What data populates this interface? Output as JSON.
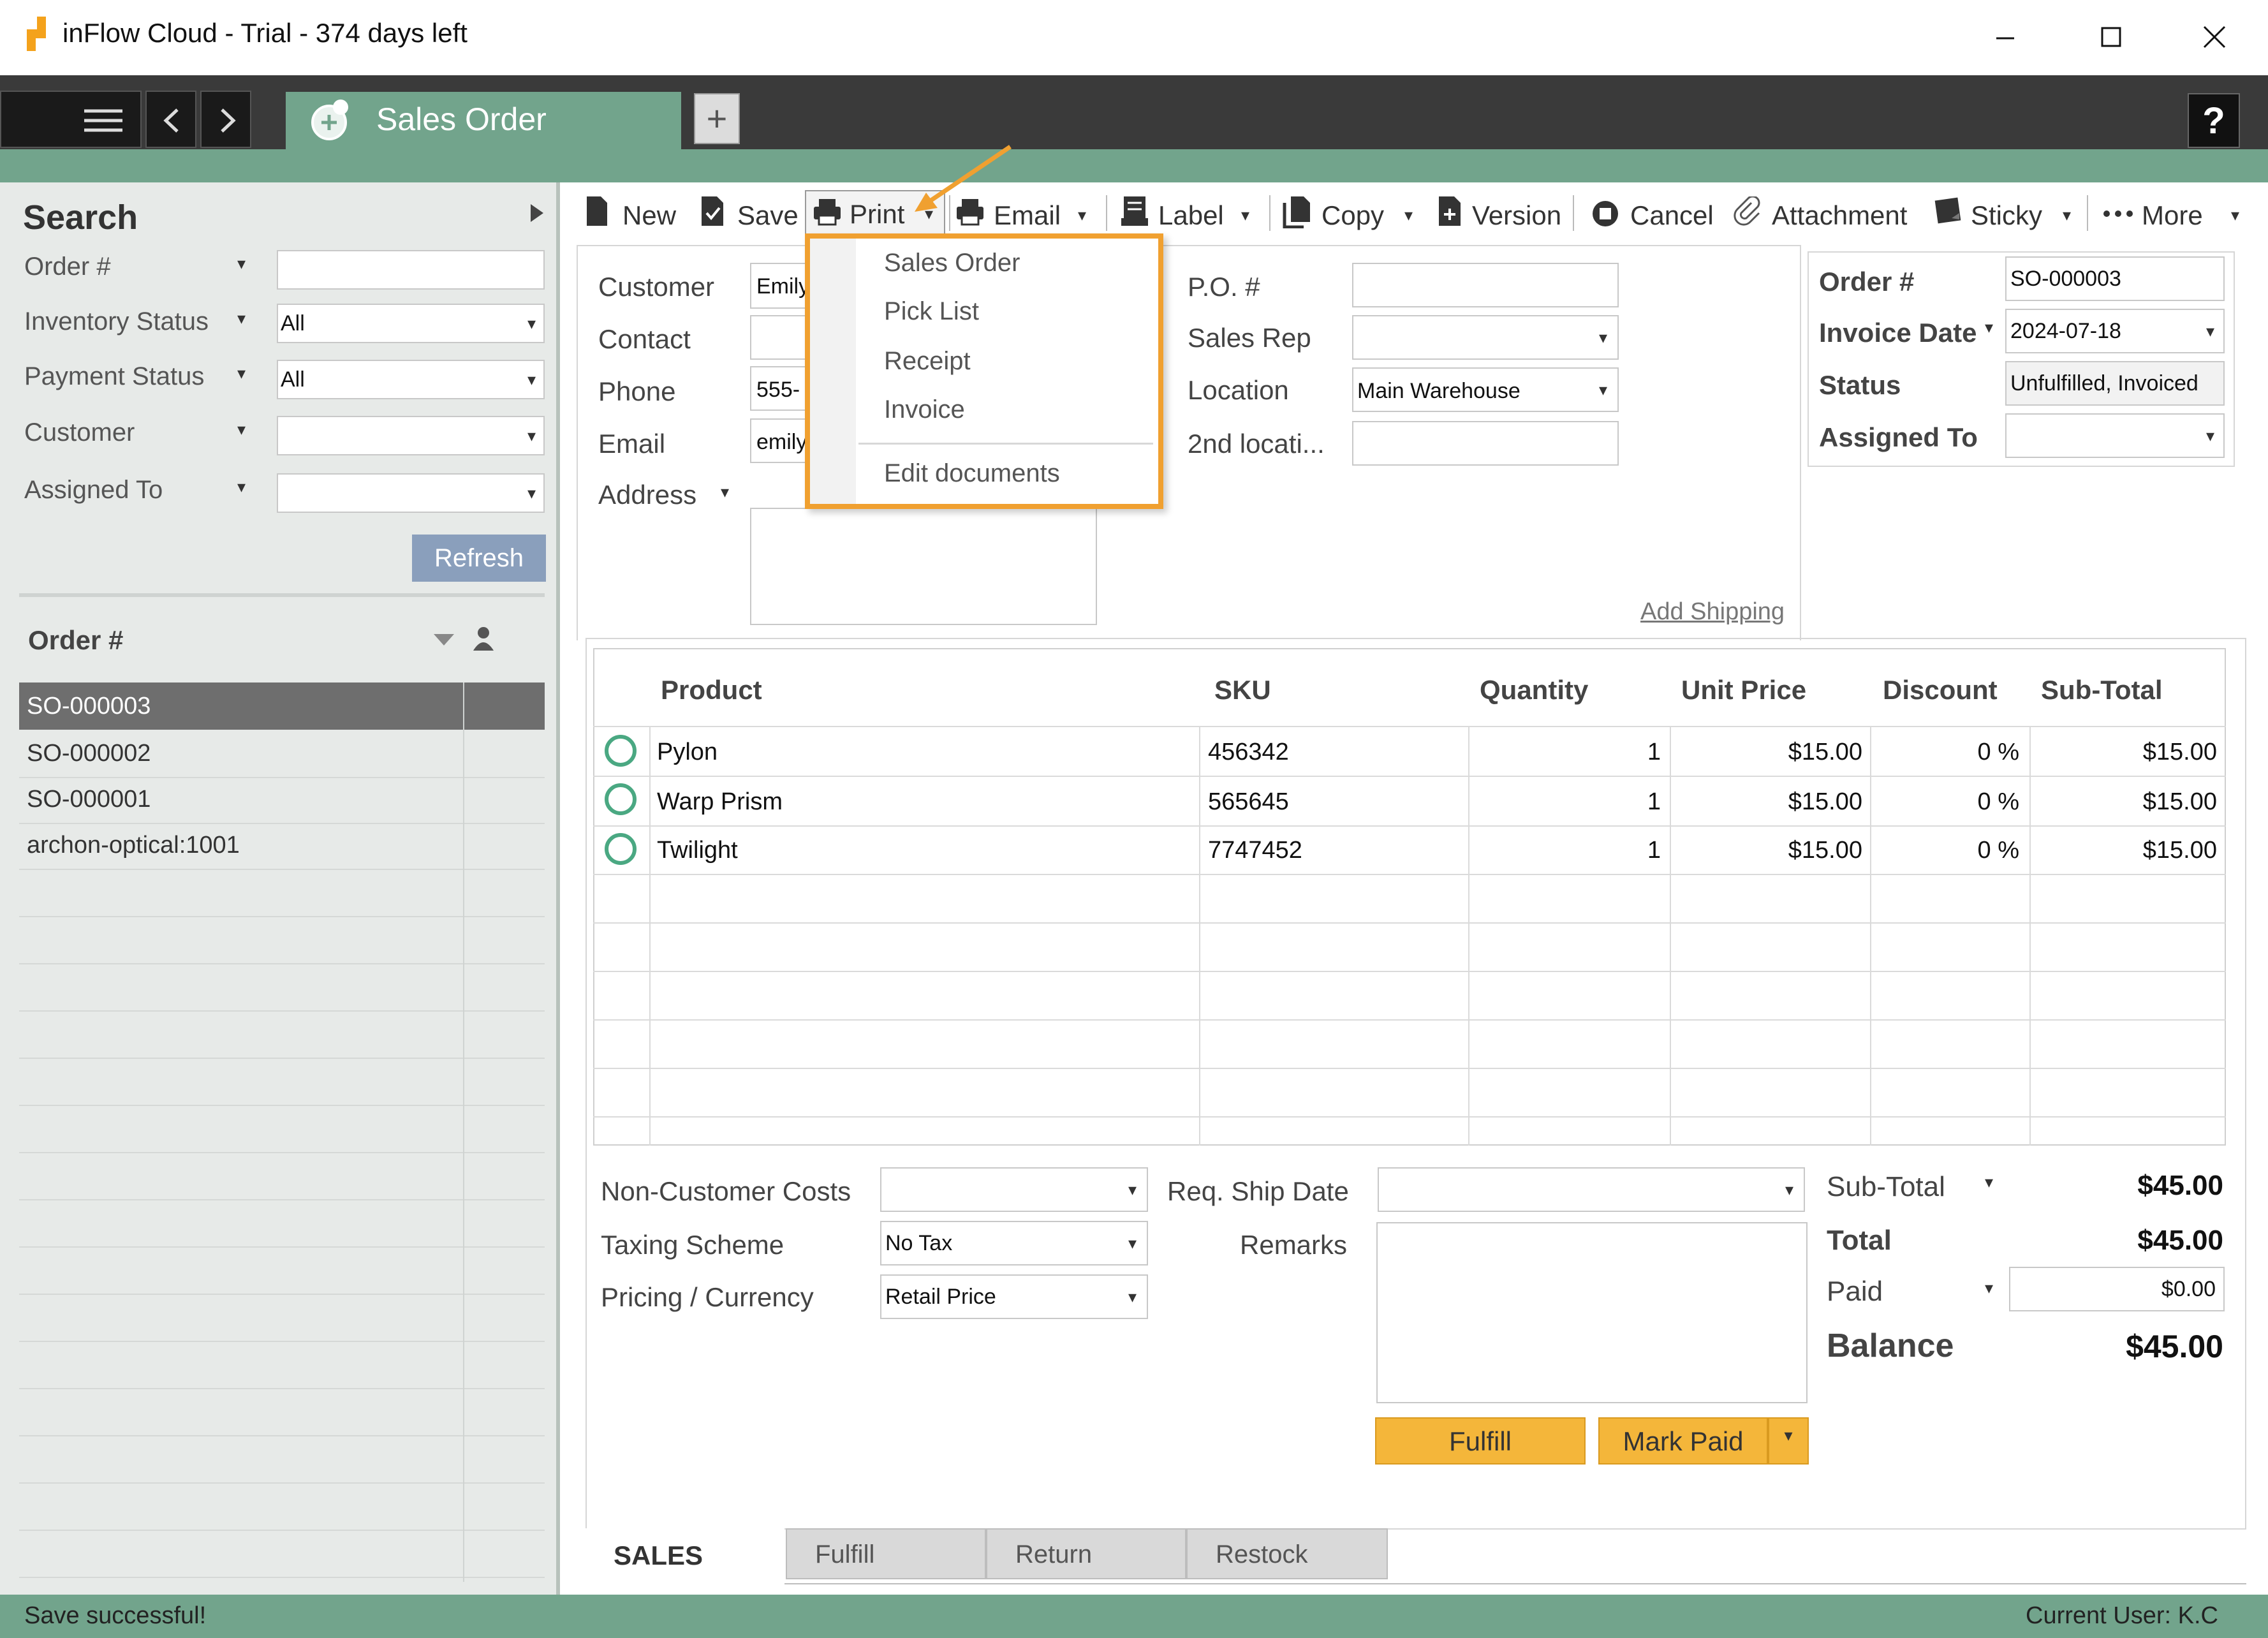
{
  "app": {
    "title": "inFlow Cloud - Trial - 374 days left"
  },
  "tabs": {
    "active_label": "Sales Order",
    "new_tab": "+",
    "help": "?"
  },
  "search": {
    "title": "Search",
    "fields": [
      {
        "label": "Order #",
        "value": ""
      },
      {
        "label": "Inventory Status",
        "value": "All"
      },
      {
        "label": "Payment Status",
        "value": "All"
      },
      {
        "label": "Customer",
        "value": ""
      },
      {
        "label": "Assigned To",
        "value": ""
      }
    ],
    "refresh_label": "Refresh",
    "list_header": "Order #",
    "orders": [
      "SO-000003",
      "SO-000002",
      "SO-000001",
      "archon-optical:1001"
    ],
    "selected_index": 0
  },
  "toolbar": {
    "new": "New",
    "save": "Save",
    "print": "Print",
    "email": "Email",
    "label": "Label",
    "copy": "Copy",
    "version": "Version",
    "cancel": "Cancel",
    "attachment": "Attachment",
    "sticky": "Sticky",
    "more": "More"
  },
  "print_menu": {
    "items": [
      "Sales Order",
      "Pick List",
      "Receipt",
      "Invoice"
    ],
    "edit_documents": "Edit documents",
    "highlight_color": "#f0a030"
  },
  "customer": {
    "customer_label": "Customer",
    "customer_value": "Emily",
    "contact_label": "Contact",
    "contact_value": "",
    "phone_label": "Phone",
    "phone_value": "555-",
    "email_label": "Email",
    "email_value": "emily",
    "address_label": "Address"
  },
  "order_info": {
    "po_label": "P.O. #",
    "po_value": "",
    "sales_rep_label": "Sales Rep",
    "sales_rep_value": "",
    "location_label": "Location",
    "location_value": "Main Warehouse",
    "second_location_label": "2nd locati...",
    "second_location_value": "",
    "add_shipping": "Add Shipping"
  },
  "order_box": {
    "order_no_label": "Order #",
    "order_no_value": "SO-000003",
    "invoice_date_label": "Invoice Date",
    "invoice_date_value": "2024-07-18",
    "status_label": "Status",
    "status_value": "Unfulfilled, Invoiced",
    "assigned_to_label": "Assigned To",
    "assigned_to_value": ""
  },
  "lines": {
    "headers": [
      "Product",
      "SKU",
      "Quantity",
      "Unit Price",
      "Discount",
      "Sub-Total"
    ],
    "rows": [
      {
        "product": "Pylon",
        "sku": "456342",
        "quantity": "1",
        "unit_price": "$15.00",
        "discount": "0 %",
        "subtotal": "$15.00"
      },
      {
        "product": "Warp Prism",
        "sku": "565645",
        "quantity": "1",
        "unit_price": "$15.00",
        "discount": "0 %",
        "subtotal": "$15.00"
      },
      {
        "product": "Twilight",
        "sku": "7747452",
        "quantity": "1",
        "unit_price": "$15.00",
        "discount": "0 %",
        "subtotal": "$15.00"
      }
    ]
  },
  "footer": {
    "non_customer_costs_label": "Non-Customer Costs",
    "non_customer_costs_value": "",
    "taxing_scheme_label": "Taxing Scheme",
    "taxing_scheme_value": "No Tax",
    "pricing_label": "Pricing / Currency",
    "pricing_value": "Retail Price",
    "req_ship_date_label": "Req. Ship Date",
    "req_ship_date_value": "",
    "remarks_label": "Remarks"
  },
  "totals": {
    "subtotal_label": "Sub-Total",
    "subtotal_value": "$45.00",
    "total_label": "Total",
    "total_value": "$45.00",
    "paid_label": "Paid",
    "paid_value": "$0.00",
    "balance_label": "Balance",
    "balance_value": "$45.00"
  },
  "actions": {
    "fulfill": "Fulfill",
    "mark_paid": "Mark Paid"
  },
  "bottom_tabs": [
    "SALES",
    "Fulfill",
    "Return",
    "Restock"
  ],
  "status": {
    "message": "Save successful!",
    "current_user": "Current User:  K.C"
  },
  "colors": {
    "accent_green": "#72a48c",
    "button_orange": "#f4b63a",
    "refresh_blue": "#8a9fbc"
  }
}
